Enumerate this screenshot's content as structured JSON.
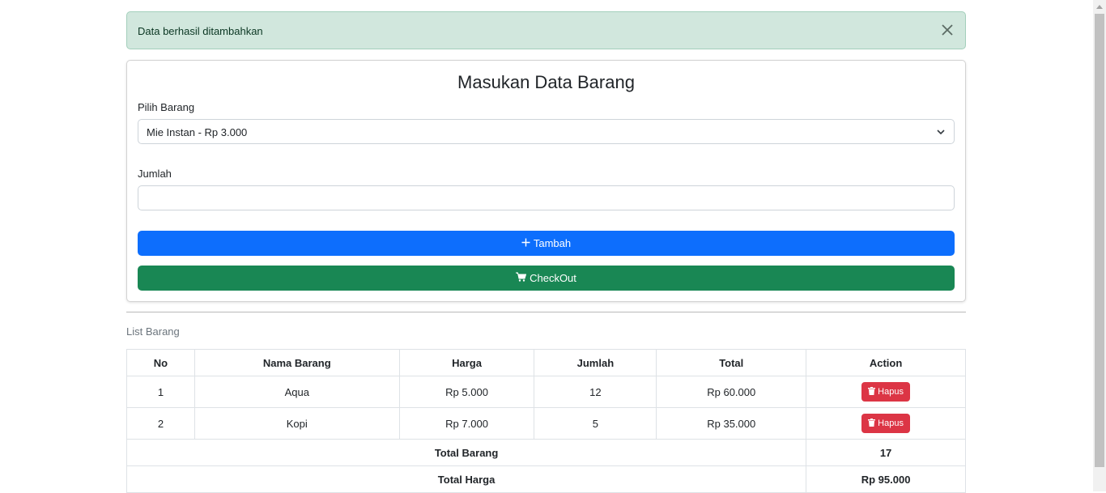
{
  "alert": {
    "message": "Data berhasil ditambahkan",
    "close_icon": "close-icon"
  },
  "form": {
    "title": "Masukan Data Barang",
    "select_label": "Pilih Barang",
    "select_value": "Mie Instan - Rp 3.000",
    "qty_label": "Jumlah",
    "qty_value": "",
    "add_button": "Tambah",
    "checkout_button": "CheckOut"
  },
  "list": {
    "caption": "List Barang",
    "columns": [
      "No",
      "Nama Barang",
      "Harga",
      "Jumlah",
      "Total",
      "Action"
    ],
    "rows": [
      {
        "no": "1",
        "name": "Aqua",
        "price": "Rp 5.000",
        "qty": "12",
        "total": "Rp 60.000",
        "action": "Hapus"
      },
      {
        "no": "2",
        "name": "Kopi",
        "price": "Rp 7.000",
        "qty": "5",
        "total": "Rp 35.000",
        "action": "Hapus"
      }
    ],
    "total_items_label": "Total Barang",
    "total_items_value": "17",
    "total_price_label": "Total Harga",
    "total_price_value": "Rp 95.000"
  },
  "colors": {
    "primary": "#0d6efd",
    "success": "#198754",
    "danger": "#dc3545",
    "alert_bg": "#d1e7dd"
  }
}
